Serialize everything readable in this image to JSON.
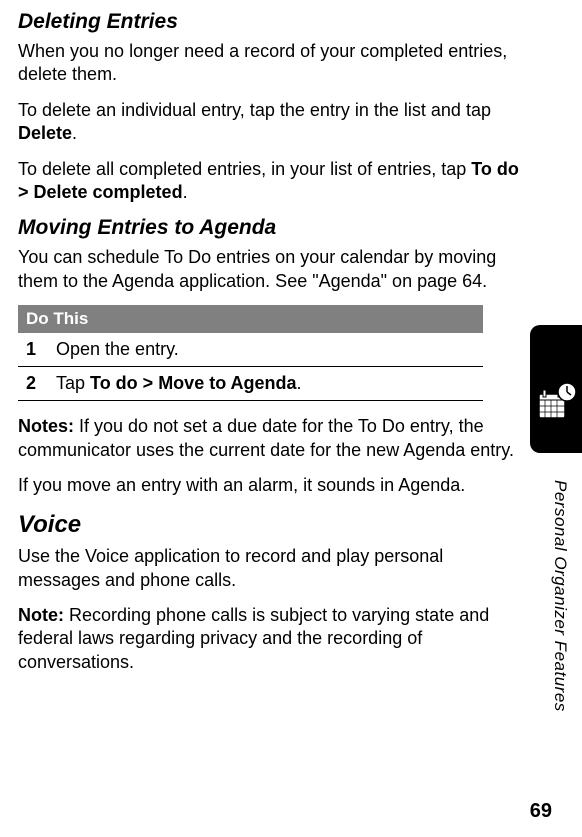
{
  "section1": {
    "heading": "Deleting Entries",
    "para1": "When you no longer need a record of your completed entries, delete them.",
    "para2_pre": "To delete an individual entry, tap the entry in the list and tap ",
    "para2_bold": "Delete",
    "para2_post": ".",
    "para3_pre": "To delete all completed entries, in your list of entries, tap ",
    "para3_bold": "To do > Delete completed",
    "para3_post": "."
  },
  "section2": {
    "heading": "Moving Entries to Agenda",
    "para1": "You can schedule To Do entries on your calendar by moving them to the Agenda application. See \"Agenda\" on page 64.",
    "table_header": "Do This",
    "steps": [
      {
        "num": "1",
        "text": "Open the entry."
      },
      {
        "num": "2",
        "pre": "Tap ",
        "bold": "To do > Move to Agenda",
        "post": "."
      }
    ],
    "notes_label": "Notes:",
    "notes_text": " If you do not set a due date for the To Do entry, the communicator uses the current date for the new Agenda entry.",
    "para3": "If you move an entry with an alarm, it sounds in Agenda."
  },
  "section3": {
    "heading": "Voice",
    "para1": "Use the Voice application to record and play personal messages and phone calls.",
    "note_label": "Note:",
    "note_text": " Recording phone calls is subject to varying state and federal laws regarding privacy and the recording of conversations."
  },
  "sidebar": {
    "label": "Personal Organizer Features"
  },
  "page_number": "69"
}
